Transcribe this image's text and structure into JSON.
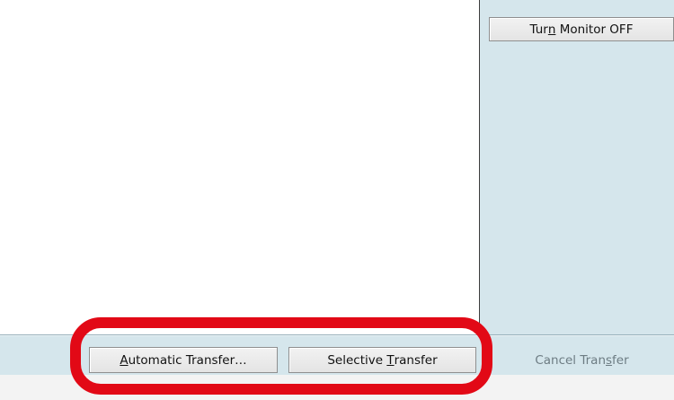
{
  "monitor": {
    "turn_off": {
      "pre": "Tur",
      "key": "n",
      "post": " Monitor OFF"
    }
  },
  "transfer": {
    "automatic": {
      "pre": "",
      "key": "A",
      "post": "utomatic Transfer…"
    },
    "selective": {
      "pre": "Selective ",
      "key": "T",
      "post": "ransfer"
    },
    "cancel": {
      "pre": "Cancel Tran",
      "key": "s",
      "post": "fer"
    }
  },
  "colors": {
    "panel_bg": "#d5e6ec",
    "highlight": "#e20916",
    "disabled_text": "#6d7c83"
  }
}
